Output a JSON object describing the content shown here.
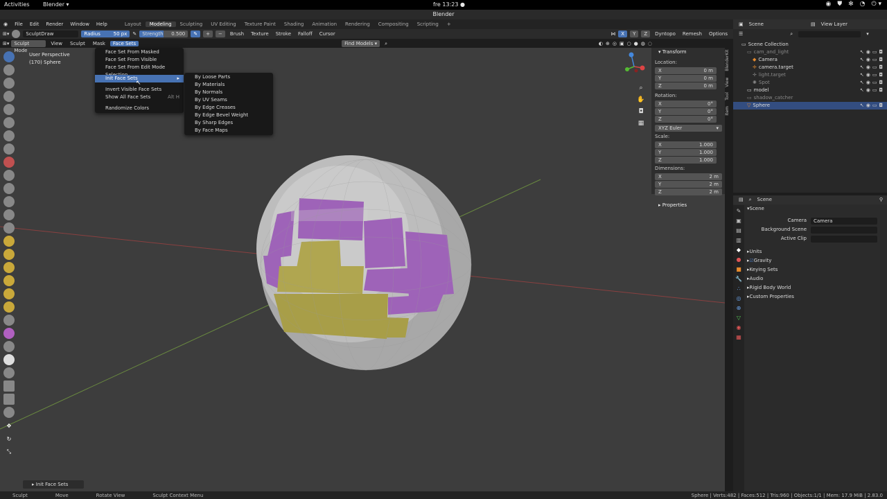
{
  "gnome": {
    "activities": "Activities",
    "app": "Blender ▾",
    "clock": "fre 13:23 ●",
    "tray": [
      "◉",
      "⛊",
      "✻",
      "◔",
      "⏻ ▾"
    ]
  },
  "window_title": "Blender",
  "menubar": {
    "items": [
      "File",
      "Edit",
      "Render",
      "Window",
      "Help"
    ],
    "workspaces": [
      "Layout",
      "Modeling",
      "Sculpting",
      "UV Editing",
      "Texture Paint",
      "Shading",
      "Animation",
      "Rendering",
      "Compositing",
      "Scripting",
      "+"
    ],
    "active_workspace": "Modeling",
    "scene": "Scene",
    "view_layer": "View Layer"
  },
  "tool_header": {
    "brush": "SculptDraw",
    "radius_label": "Radius",
    "radius_value": "50 px",
    "strength_label": "Strength",
    "strength_value": "0.500",
    "brush_menu": "Brush",
    "texture_menu": "Texture",
    "stroke_menu": "Stroke",
    "falloff_menu": "Falloff",
    "cursor_menu": "Cursor",
    "axis": [
      "X",
      "Y",
      "Z"
    ],
    "dyntopo": "Dyntopo",
    "remesh": "Remesh",
    "options": "Options"
  },
  "viewport_header": {
    "mode": "Sculpt Mode",
    "menus": [
      "View",
      "Sculpt",
      "Mask",
      "Face Sets"
    ],
    "active_menu": "Face Sets",
    "find_models": "Find Models"
  },
  "viewport_info": {
    "line1": "User Perspective",
    "line2": "(170) Sphere"
  },
  "face_sets_menu": {
    "items": [
      "Face Set From Masked",
      "Face Set From Visible",
      "Face Set From Edit Mode Selection",
      "Init Face Sets",
      "Invert Visible Face Sets",
      "Show All Face Sets",
      "Randomize Colors"
    ],
    "show_all_shortcut": "Alt H",
    "highlighted": "Init Face Sets"
  },
  "init_submenu": {
    "items": [
      "By Loose Parts",
      "By Materials",
      "By Normals",
      "By UV Seams",
      "By Edge Creases",
      "By Edge Bevel Weight",
      "By Sharp Edges",
      "By Face Maps"
    ]
  },
  "npanel": {
    "title": "Transform",
    "location_label": "Location:",
    "location": [
      {
        "axis": "X",
        "value": "0 m"
      },
      {
        "axis": "Y",
        "value": "0 m"
      },
      {
        "axis": "Z",
        "value": "0 m"
      }
    ],
    "rotation_label": "Rotation:",
    "rotation": [
      {
        "axis": "X",
        "value": "0°"
      },
      {
        "axis": "Y",
        "value": "0°"
      },
      {
        "axis": "Z",
        "value": "0°"
      }
    ],
    "rot_mode": "XYZ Euler",
    "scale_label": "Scale:",
    "scale": [
      {
        "axis": "X",
        "value": "1.000"
      },
      {
        "axis": "Y",
        "value": "1.000"
      },
      {
        "axis": "Z",
        "value": "1.000"
      }
    ],
    "dimensions_label": "Dimensions:",
    "dimensions": [
      {
        "axis": "X",
        "value": "2 m"
      },
      {
        "axis": "Y",
        "value": "2 m"
      },
      {
        "axis": "Z",
        "value": "2 m"
      }
    ],
    "properties": "Properties",
    "tabs": [
      "Item",
      "Tool",
      "View",
      "BlenderKit"
    ]
  },
  "outliner": {
    "root": "Scene Collection",
    "items": [
      {
        "name": "cam_and_light",
        "dim": true
      },
      {
        "name": "Camera",
        "dim": false
      },
      {
        "name": "camera.target",
        "dim": false
      },
      {
        "name": "light.target",
        "dim": true
      },
      {
        "name": "Spot",
        "dim": true
      },
      {
        "name": "model",
        "dim": false
      },
      {
        "name": "shadow_catcher",
        "dim": true
      },
      {
        "name": "Sphere",
        "dim": false
      }
    ],
    "selected": "Sphere"
  },
  "properties_panel": {
    "header": "Scene",
    "section": "Scene",
    "camera_label": "Camera",
    "camera_value": "Camera",
    "bg_label": "Background Scene",
    "clip_label": "Active Clip",
    "subsections": [
      "Units",
      "Gravity",
      "Keying Sets",
      "Audio",
      "Rigid Body World",
      "Custom Properties"
    ]
  },
  "last_op": "Init Face Sets",
  "statusbar": {
    "items": [
      "Sculpt",
      "Move",
      "Rotate View",
      "Sculpt Context Menu"
    ],
    "stats": "Sphere | Verts:482 | Faces:512 | Tris:960 | Objects:1/1 | Mem: 17.9 MiB | 2.83.0"
  },
  "colors": {
    "accent": "#4772b3",
    "viewport": "#3d3d3d",
    "purple": "#9e63b8",
    "yellow": "#b0a650"
  }
}
